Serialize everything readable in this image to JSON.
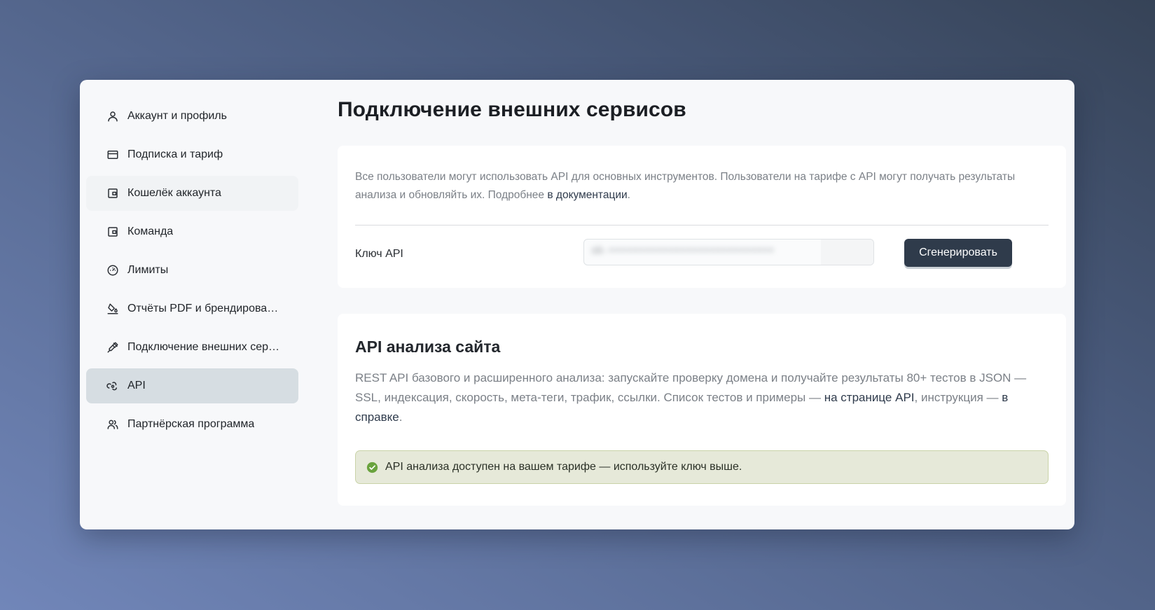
{
  "sidebar": {
    "items": [
      {
        "label": "Аккаунт и профиль",
        "icon": "user-icon"
      },
      {
        "label": "Подписка и тариф",
        "icon": "credit-card-icon"
      },
      {
        "label": "Кошелёк аккаунта",
        "icon": "wallet-icon"
      },
      {
        "label": "Команда",
        "icon": "wallet-icon"
      },
      {
        "label": "Лимиты",
        "icon": "gauge-icon"
      },
      {
        "label": "Отчёты PDF и брендирова…",
        "icon": "paint-bucket-icon"
      },
      {
        "label": "Подключение внешних сер…",
        "icon": "plug-icon"
      },
      {
        "label": "API",
        "icon": "api-webhook-icon",
        "active": true
      },
      {
        "label": "Партнёрская программа",
        "icon": "users-icon"
      }
    ]
  },
  "main": {
    "title": "Подключение внешних сервисов",
    "api_key_card": {
      "intro_text": "Все пользователи могут использовать API для основных инструментов. Пользователи на тарифе с API могут получать результаты анализа и обновляйть их. Подробнее ",
      "intro_link": "в документации",
      "intro_end": ".",
      "key_label": "Ключ API",
      "key_value_masked": "sk-••••••••••••••••••••••••••••",
      "generate_button": "Сгенерировать"
    },
    "analysis_card": {
      "title": "API анализа сайта",
      "desc_1": "REST API базового и расширенного анализа: запускайте проверку домена и получайте результаты 80+ тестов в JSON — SSL, индексация, скорость, мета-теги, трафик, ссылки. Список тестов и примеры — ",
      "desc_link_1": "на странице API",
      "desc_2": ", инструкция — ",
      "desc_link_2": "в справке",
      "desc_end": ".",
      "alert_text": "API анализа доступен на вашем тарифе — используйте ключ выше.",
      "alert_icon": "check-circle-icon"
    }
  },
  "colors": {
    "primary_button": "#2f3b4b",
    "success_check": "#6aa33e",
    "active_nav": "#d6dde2"
  }
}
